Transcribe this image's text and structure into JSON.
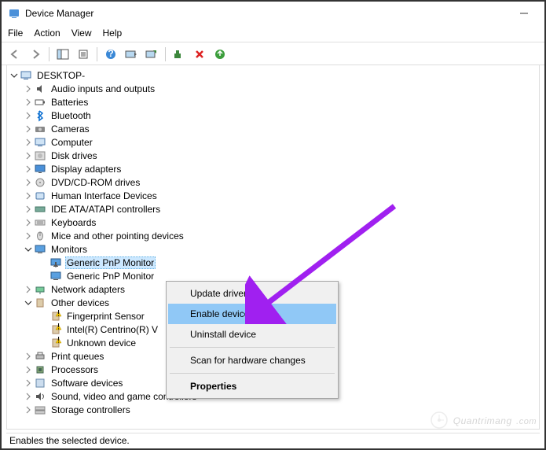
{
  "window": {
    "title": "Device Manager",
    "minimize": "–"
  },
  "menu": {
    "file": "File",
    "action": "Action",
    "view": "View",
    "help": "Help"
  },
  "status": "Enables the selected device.",
  "root": "DESKTOP-",
  "categories": [
    {
      "label": "Audio inputs and outputs",
      "icon": "audio"
    },
    {
      "label": "Batteries",
      "icon": "battery"
    },
    {
      "label": "Bluetooth",
      "icon": "bluetooth"
    },
    {
      "label": "Cameras",
      "icon": "camera"
    },
    {
      "label": "Computer",
      "icon": "computer"
    },
    {
      "label": "Disk drives",
      "icon": "disk"
    },
    {
      "label": "Display adapters",
      "icon": "display"
    },
    {
      "label": "DVD/CD-ROM drives",
      "icon": "cdrom"
    },
    {
      "label": "Human Interface Devices",
      "icon": "hid"
    },
    {
      "label": "IDE ATA/ATAPI controllers",
      "icon": "ide"
    },
    {
      "label": "Keyboards",
      "icon": "keyboard"
    },
    {
      "label": "Mice and other pointing devices",
      "icon": "mouse"
    },
    {
      "label": "Monitors",
      "icon": "monitor",
      "open": true,
      "children": [
        {
          "label": "Generic PnP Monitor",
          "icon": "monitor",
          "selected": true,
          "disabled": true
        },
        {
          "label": "Generic PnP Monitor",
          "icon": "monitor"
        }
      ]
    },
    {
      "label": "Network adapters",
      "icon": "network"
    },
    {
      "label": "Other devices",
      "icon": "other",
      "open": true,
      "children": [
        {
          "label": "Fingerprint Sensor",
          "icon": "other",
          "warn": true
        },
        {
          "label": "Intel(R) Centrino(R) V",
          "icon": "other",
          "warn": true
        },
        {
          "label": "Unknown device",
          "icon": "other",
          "warn": true
        }
      ]
    },
    {
      "label": "Print queues",
      "icon": "printer"
    },
    {
      "label": "Processors",
      "icon": "cpu"
    },
    {
      "label": "Software devices",
      "icon": "software"
    },
    {
      "label": "Sound, video and game controllers",
      "icon": "sound"
    },
    {
      "label": "Storage controllers",
      "icon": "storage"
    }
  ],
  "context": {
    "items": [
      {
        "label": "Update driver"
      },
      {
        "label": "Enable device",
        "highlight": true
      },
      {
        "label": "Uninstall device"
      }
    ],
    "scan": "Scan for hardware changes",
    "props": "Properties"
  },
  "watermark": "Quantrimang"
}
